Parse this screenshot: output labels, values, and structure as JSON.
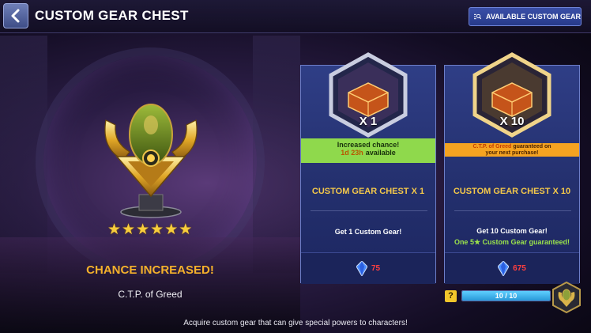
{
  "header": {
    "title": "CUSTOM GEAR CHEST",
    "available_button_label": "AVAILABLE CUSTOM GEAR"
  },
  "showcase": {
    "star_count": 6,
    "chance_title": "CHANCE INCREASED!",
    "gear_name": "C.T.P. of Greed"
  },
  "cards": [
    {
      "multiplier": "X 1",
      "banner_line1": "Increased chance!",
      "banner_timer": "1d 23h",
      "banner_line2": "available",
      "name": "CUSTOM GEAR CHEST X 1",
      "desc": "Get 1 Custom Gear!",
      "price": "75"
    },
    {
      "multiplier": "X 10",
      "banner_highlight": "C.T.P. of Greed",
      "banner_line1": "guaranteed on",
      "banner_line2": "your next purchase!",
      "name": "CUSTOM GEAR CHEST X 10",
      "desc": "Get 10 Custom Gear!",
      "desc2": "One 5★ Custom Gear guaranteed!",
      "price": "675"
    }
  ],
  "progress": {
    "help_label": "?",
    "text": "10 / 10",
    "fraction": 1.0
  },
  "footer": {
    "text": "Acquire custom gear that can give special powers to characters!"
  },
  "colors": {
    "accent_gold": "#f5b12b",
    "card_name": "#f4c84a",
    "green_banner": "#8fd94c",
    "orange_banner": "#f5a321",
    "price_red": "#ff3f3f"
  }
}
